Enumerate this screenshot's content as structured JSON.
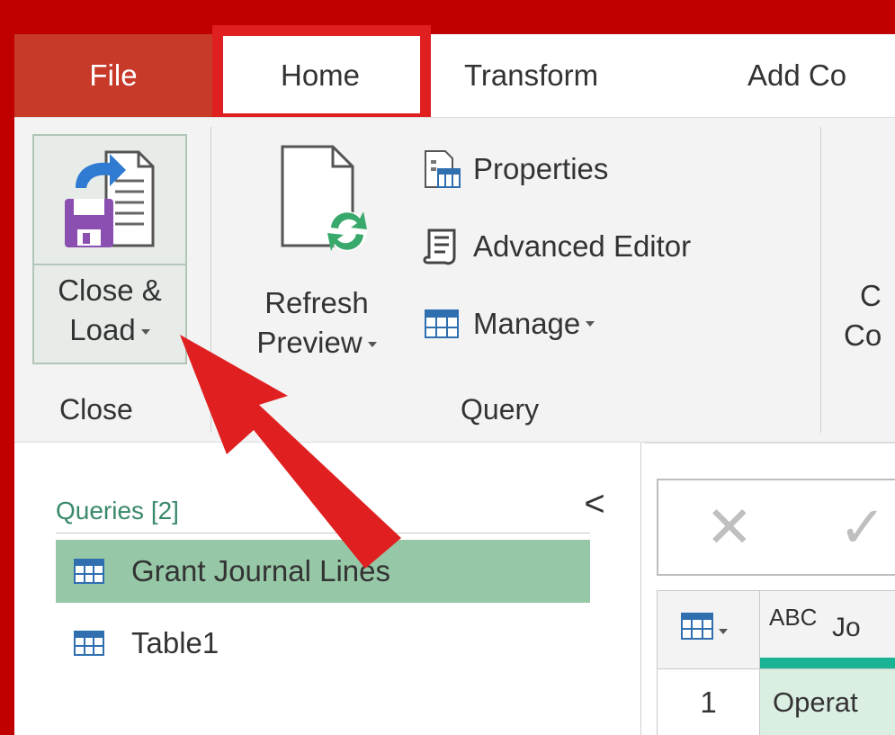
{
  "tabs": {
    "file": "File",
    "home": "Home",
    "transform": "Transform",
    "add_column": "Add Co"
  },
  "ribbon": {
    "close_group": {
      "button_line1": "Close &",
      "button_line2": "Load",
      "label": "Close"
    },
    "query_group": {
      "refresh_line1": "Refresh",
      "refresh_line2": "Preview",
      "properties": "Properties",
      "advanced_editor": "Advanced Editor",
      "manage": "Manage",
      "label": "Query"
    },
    "next_group": {
      "line1": "C",
      "line2": "Co"
    }
  },
  "queries": {
    "title": "Queries [2]",
    "collapse": "<",
    "items": [
      {
        "label": "Grant Journal Lines",
        "selected": true
      },
      {
        "label": "Table1",
        "selected": false
      }
    ]
  },
  "grid": {
    "column_type": "ABC",
    "column_name": "Jo",
    "row_number": "1",
    "cell_value": "Operat"
  },
  "colors": {
    "frame": "#c00000",
    "file_tab": "#c73a2a",
    "highlight": "#e02020",
    "selected_query": "#96c8a7",
    "column_accent": "#1ab394"
  }
}
